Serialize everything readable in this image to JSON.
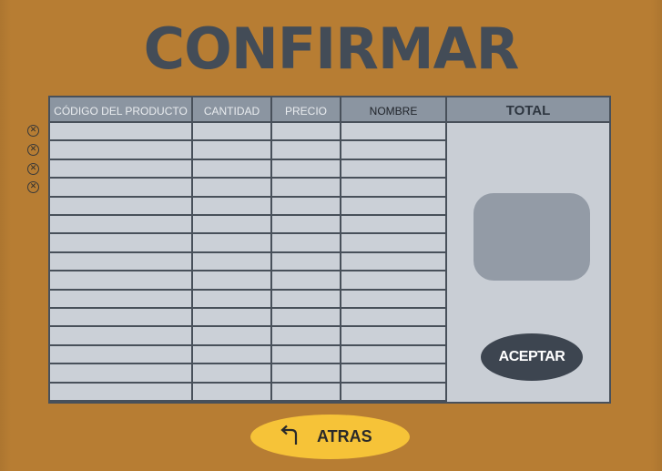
{
  "title": "CONFIRMAR",
  "table": {
    "headers": [
      "CÓDIGO DEL PRODUCTO",
      "CANTIDAD",
      "PRECIO",
      "NOMBRE"
    ],
    "total_header": "TOTAL",
    "row_count": 15
  },
  "remove_icon": "close-circle-icon",
  "accept_label": "ACEPTAR",
  "back": {
    "label": "ATRAS",
    "icon": "return-arrow-icon"
  },
  "colors": {
    "background": "#b77d33",
    "title": "#434c57",
    "header": "#8b95a1",
    "cell": "#cbd0d7",
    "accept_button": "#3d4550",
    "back_button": "#f6c338"
  }
}
